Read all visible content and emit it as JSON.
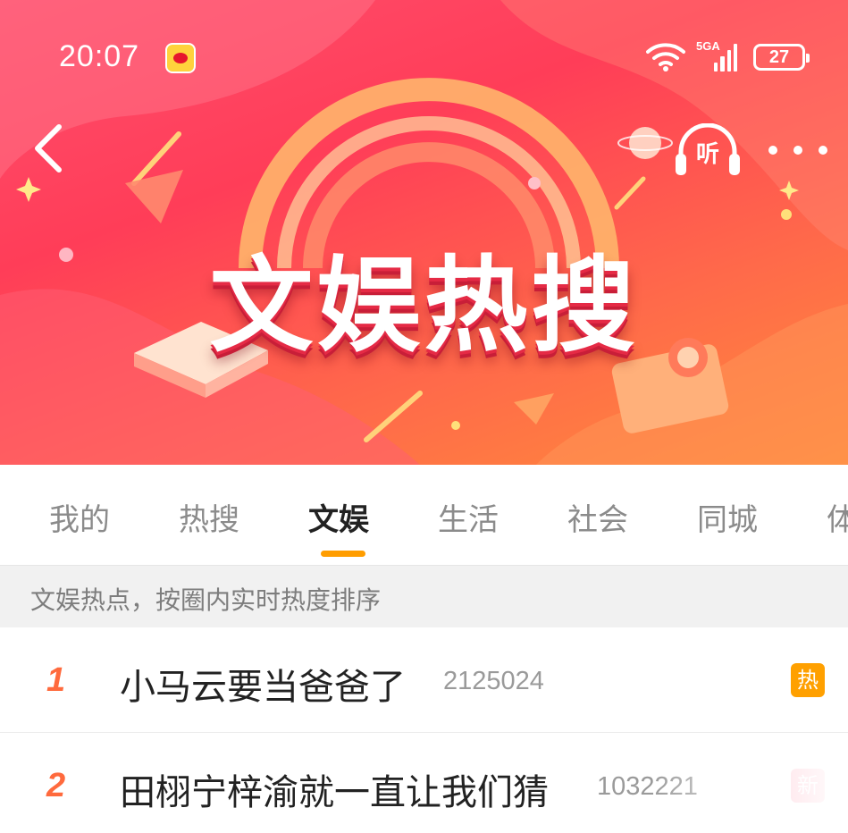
{
  "status_bar": {
    "time": "20:07",
    "network_type": "5GA",
    "battery_level": "27",
    "wifi_icon": "wifi-icon",
    "signal_icon": "signal-bars-icon"
  },
  "header": {
    "back_icon": "chevron-left-icon",
    "listen_label": "听",
    "more_icon": "more-dots-icon",
    "banner_title": "文娱热搜"
  },
  "tabs": [
    {
      "label": "我的",
      "active": false
    },
    {
      "label": "热搜",
      "active": false
    },
    {
      "label": "文娱",
      "active": true
    },
    {
      "label": "生活",
      "active": false
    },
    {
      "label": "社会",
      "active": false
    },
    {
      "label": "同城",
      "active": false
    },
    {
      "label": "体",
      "active": false
    }
  ],
  "hint": "文娱热点，按圈内实时热度排序",
  "list": [
    {
      "rank": "1",
      "title": "小马云要当爸爸了",
      "heat": "2125024",
      "badge": "热",
      "badge_color": "#ffa000"
    },
    {
      "rank": "2",
      "title": "田栩宁梓渝就一直让我们猜",
      "heat": "1032221",
      "badge": "新",
      "badge_color": "#ff4e73"
    }
  ],
  "colors": {
    "accent_orange": "#ff9d00",
    "rank_color": "#ff6a3d",
    "banner_red": "#ff3d58"
  }
}
